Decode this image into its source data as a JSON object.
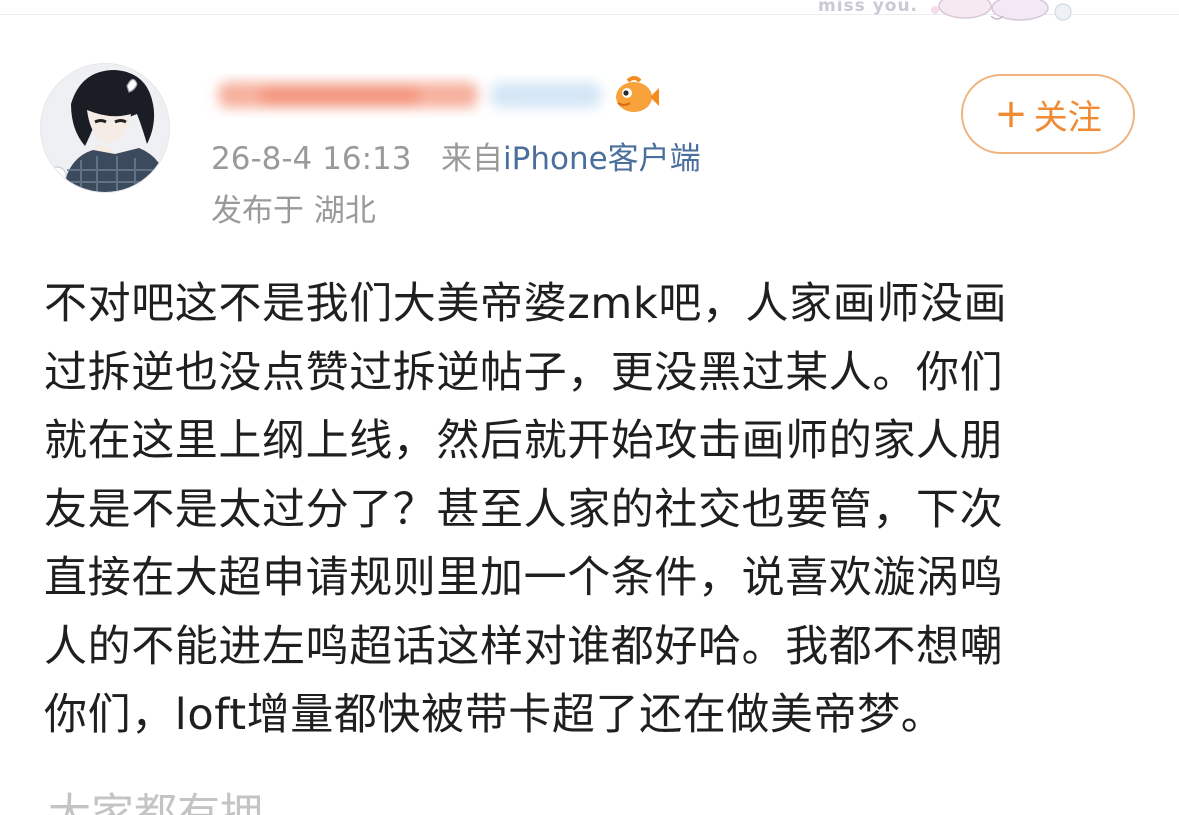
{
  "header": {
    "sticker_text": "miss you."
  },
  "post": {
    "author": {
      "display_name": "",
      "name_obscured": true
    },
    "meta": {
      "timestamp": "26-8-4 16:13",
      "source_prefix": "来自",
      "source": "iPhone客户端",
      "location": "发布于 湖北"
    },
    "follow_button": {
      "plus": "+",
      "label": "关注"
    },
    "body_lines": [
      "不对吧这不是我们大美帝婆zmk吧，人家画师没画",
      "过拆逆也没点赞过拆逆帖子，更没黑过某人。你们",
      "就在这里上纲上线，然后就开始攻击画师的家人朋",
      "友是不是太过分了？甚至人家的社交也要管，下次",
      "直接在大超申请规则里加一个条件，说喜欢漩涡鸣",
      "人的不能进左鸣超话这样对谁都好哈。我都不想嘲",
      "你们，loft增量都快被带卡超了还在做美帝梦。"
    ],
    "next_line_partial": "大家都有拥"
  },
  "colors": {
    "follow_accent": "#f08a33",
    "follow_border": "#f0b37e",
    "meta_gray": "#9a9a9a",
    "source_blue": "#4a6f9c",
    "body_text": "#1f1f1f"
  }
}
